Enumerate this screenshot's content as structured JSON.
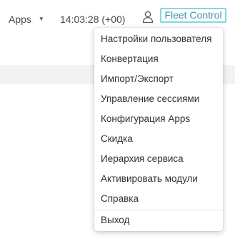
{
  "header": {
    "apps_label": "Apps",
    "clock": "14:03:28 (+00)",
    "product_name": "Fleet Control",
    "user_icon": "user-icon",
    "caret_icon": "caret-down-icon"
  },
  "colors": {
    "badge_border": "#82d8e3",
    "badge_text": "#3e98a6"
  },
  "user_menu": {
    "items": [
      "Настройки пользователя",
      "Конвертация",
      "Импорт/Экспорт",
      "Управление сессиями",
      "Конфигурация Apps",
      "Скидка",
      "Иерархия сервиса",
      "Активировать модули",
      "Справка"
    ],
    "logout": "Выход"
  }
}
